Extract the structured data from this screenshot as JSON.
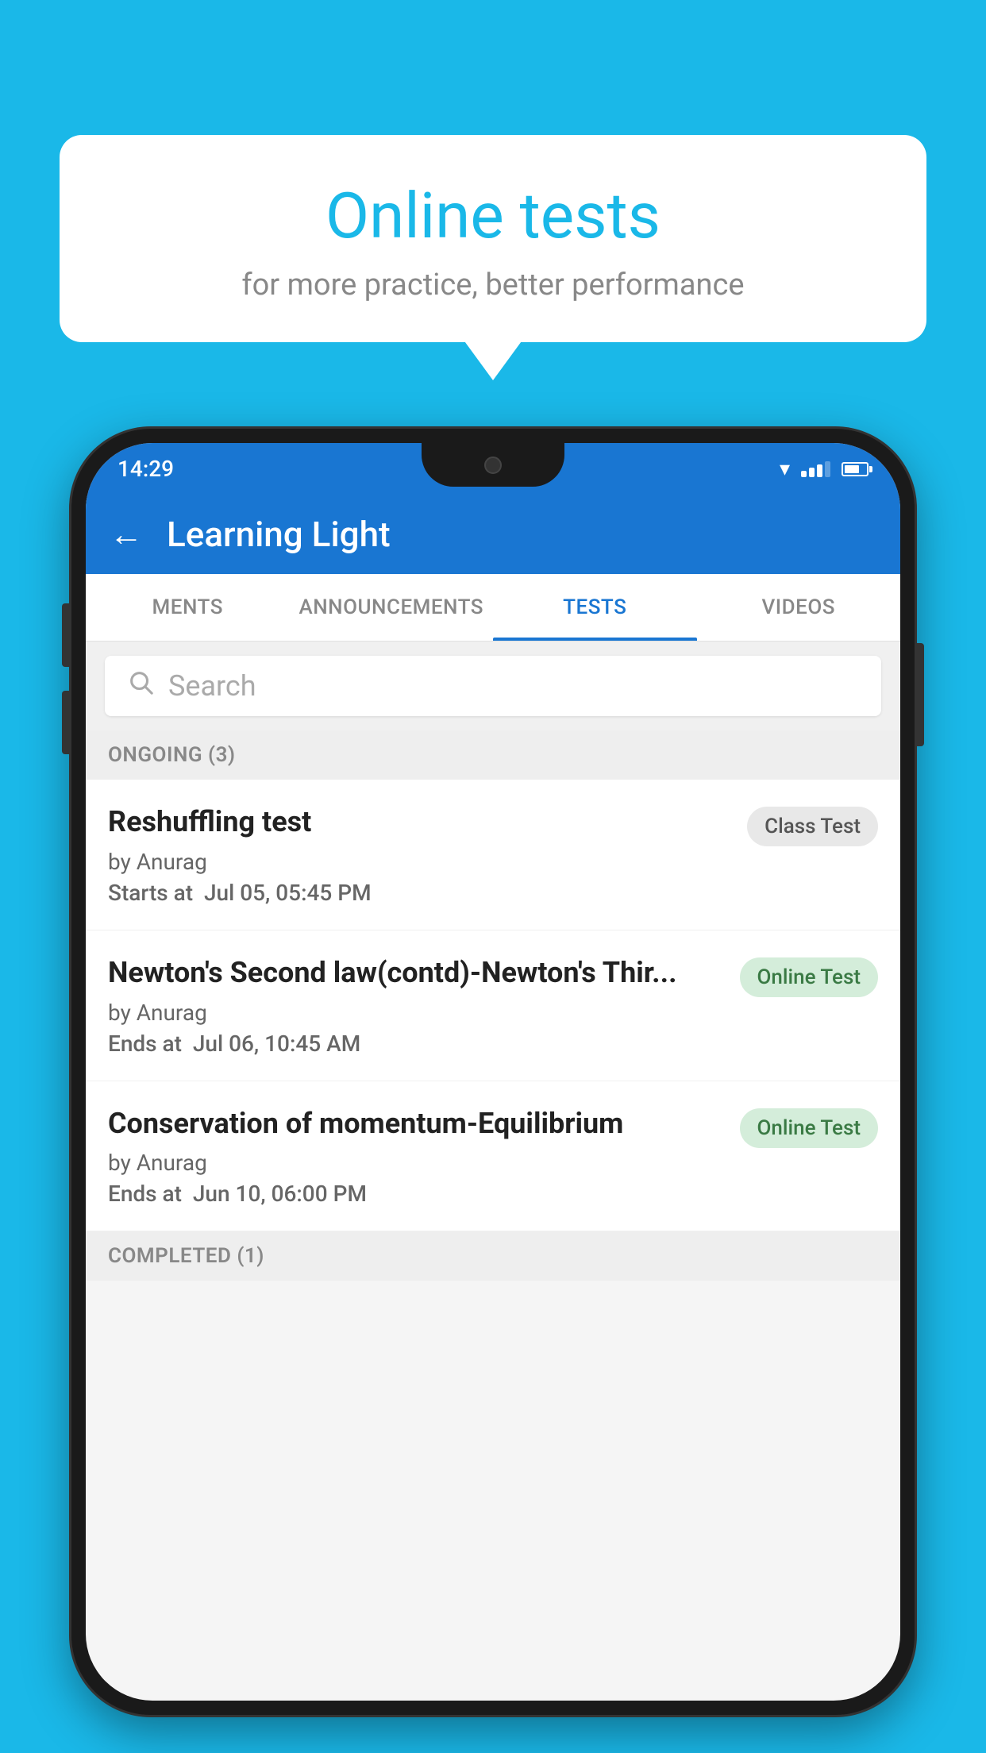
{
  "background_color": "#1ab8e8",
  "speech_bubble": {
    "title": "Online tests",
    "subtitle": "for more practice, better performance"
  },
  "phone": {
    "status_bar": {
      "time": "14:29"
    },
    "app_bar": {
      "title": "Learning Light"
    },
    "tabs": [
      {
        "label": "MENTS",
        "active": false
      },
      {
        "label": "ANNOUNCEMENTS",
        "active": false
      },
      {
        "label": "TESTS",
        "active": true
      },
      {
        "label": "VIDEOS",
        "active": false
      }
    ],
    "search": {
      "placeholder": "Search"
    },
    "ongoing_section": {
      "title": "ONGOING (3)"
    },
    "test_items": [
      {
        "name": "Reshuffling test",
        "author": "by Anurag",
        "time_label": "Starts at",
        "time_value": "Jul 05, 05:45 PM",
        "badge": "Class Test",
        "badge_type": "class"
      },
      {
        "name": "Newton's Second law(contd)-Newton's Thir...",
        "author": "by Anurag",
        "time_label": "Ends at",
        "time_value": "Jul 06, 10:45 AM",
        "badge": "Online Test",
        "badge_type": "online"
      },
      {
        "name": "Conservation of momentum-Equilibrium",
        "author": "by Anurag",
        "time_label": "Ends at",
        "time_value": "Jun 10, 06:00 PM",
        "badge": "Online Test",
        "badge_type": "online"
      }
    ],
    "completed_section": {
      "title": "COMPLETED (1)"
    }
  }
}
